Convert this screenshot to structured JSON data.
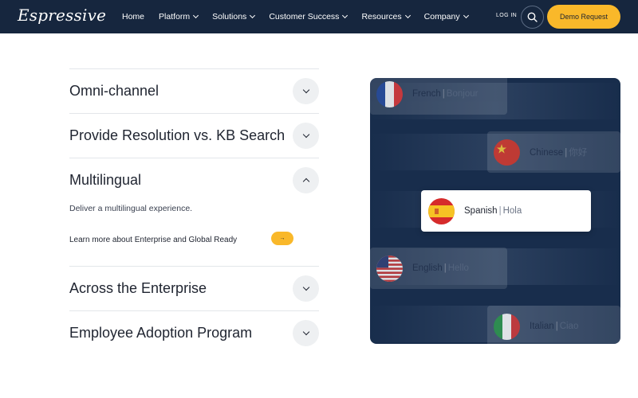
{
  "header": {
    "logo": "Espressive",
    "nav": [
      {
        "label": "Home",
        "has_dropdown": false
      },
      {
        "label": "Platform",
        "has_dropdown": true
      },
      {
        "label": "Solutions",
        "has_dropdown": true
      },
      {
        "label": "Customer Success",
        "has_dropdown": true
      },
      {
        "label": "Resources",
        "has_dropdown": true
      },
      {
        "label": "Company",
        "has_dropdown": true
      }
    ],
    "login": "LOG IN",
    "search_icon": "search-icon",
    "demo_button": "Demo Request"
  },
  "accordion": {
    "items": [
      {
        "title": "Omni-channel",
        "expanded": false
      },
      {
        "title": "Provide Resolution vs. KB Search",
        "expanded": false
      },
      {
        "title": "Multilingual",
        "expanded": true
      },
      {
        "title": "Across the Enterprise",
        "expanded": false
      },
      {
        "title": "Employee Adoption Program",
        "expanded": false
      }
    ],
    "expanded_body": {
      "description": "Deliver a multilingual experience.",
      "link": "Learn more about Enterprise and Global Ready",
      "link_button": "→"
    }
  },
  "languages": [
    {
      "language": "French",
      "greeting": "Bonjour",
      "flag": "france-flag",
      "state": "faded"
    },
    {
      "language": "Chinese",
      "greeting": "你好",
      "flag": "china-flag",
      "state": "faded"
    },
    {
      "language": "Spanish",
      "greeting": "Hola",
      "flag": "spain-flag",
      "state": "active"
    },
    {
      "language": "English",
      "greeting": "Hello",
      "flag": "usa-flag",
      "state": "faded"
    },
    {
      "language": "Italian",
      "greeting": "Ciao",
      "flag": "italy-flag",
      "state": "faded"
    }
  ],
  "colors": {
    "header_bg": "#16263e",
    "accent": "#f9b82a",
    "panel_bg": "#182d4c"
  }
}
